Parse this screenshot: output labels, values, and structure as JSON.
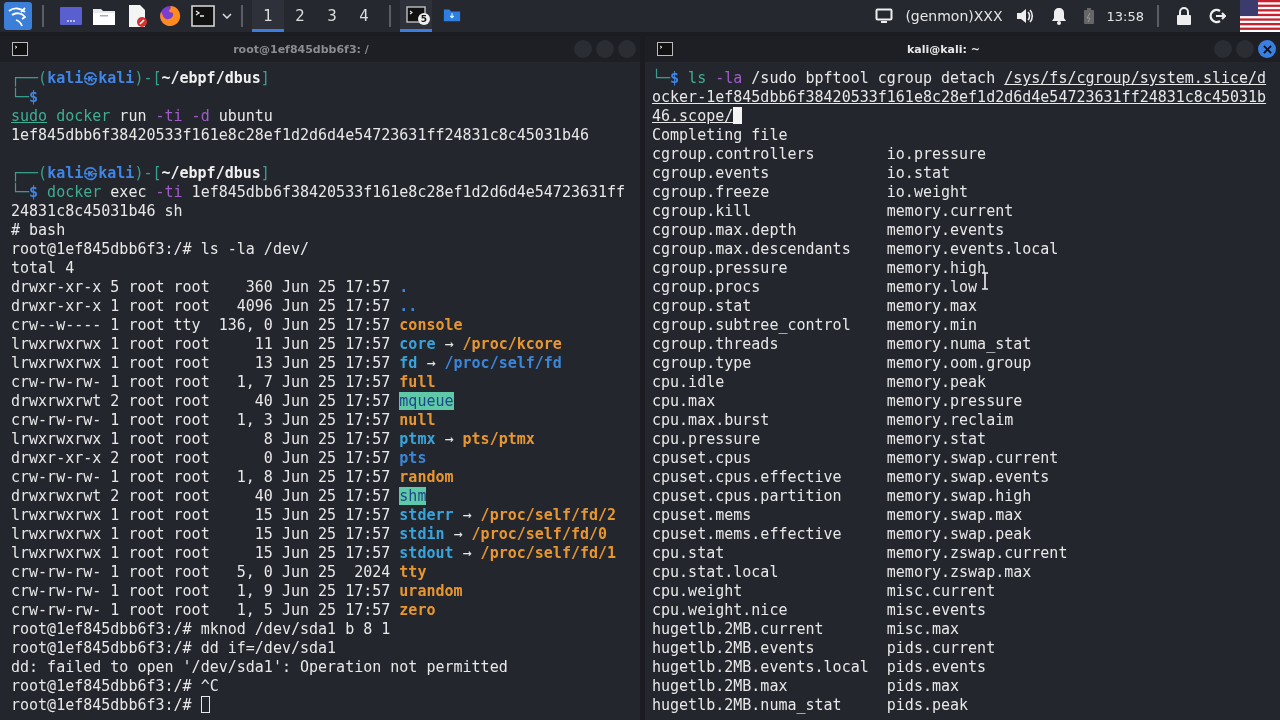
{
  "panel": {
    "workspaces": [
      {
        "label": "1",
        "selected": true
      },
      {
        "label": "2",
        "selected": false
      },
      {
        "label": "3",
        "selected": false
      },
      {
        "label": "4",
        "selected": false
      }
    ],
    "tasks": [
      {
        "kind": "terminal",
        "badge": "5",
        "selected": true
      },
      {
        "kind": "folder",
        "selected": false
      }
    ],
    "genmon": "(genmon)XXX",
    "clock": "13:58"
  },
  "terminals": [
    {
      "title": "root@1ef845dbb6f3: /",
      "active": false,
      "lines": [
        {
          "segs": [
            {
              "text": "┌──(",
              "kind": "frame"
            },
            {
              "text": "kali㉿kali",
              "kind": "host"
            },
            {
              "text": ")-[",
              "kind": "frame"
            },
            {
              "text": "~/ebpf/dbus",
              "kind": "path"
            },
            {
              "text": "]",
              "kind": "frame"
            }
          ]
        },
        {
          "segs": [
            {
              "text": "└─",
              "kind": "frame"
            },
            {
              "text": "$",
              "kind": "dollar"
            }
          ]
        },
        {
          "segs": [
            {
              "text": "sudo",
              "kind": "underlined"
            },
            {
              "text": " docker",
              "kind": "command"
            },
            {
              "text": " run ",
              "kind": "plain"
            },
            {
              "text": "-ti -d",
              "kind": "option"
            },
            {
              "text": " ubuntu",
              "kind": "plain"
            }
          ]
        },
        {
          "segs": [
            {
              "text": "1ef845dbb6f38420533f161e8c28ef1d2d6d4e54723631ff24831c8c45031b46",
              "kind": "plain"
            }
          ]
        },
        {
          "kind": "blank"
        },
        {
          "segs": [
            {
              "text": "┌──(",
              "kind": "frame"
            },
            {
              "text": "kali㉿kali",
              "kind": "host"
            },
            {
              "text": ")-[",
              "kind": "frame"
            },
            {
              "text": "~/ebpf/dbus",
              "kind": "path"
            },
            {
              "text": "]",
              "kind": "frame"
            }
          ]
        },
        {
          "segs": [
            {
              "text": "└─",
              "kind": "frame"
            },
            {
              "text": "$",
              "kind": "dollar"
            },
            {
              "text": " docker",
              "kind": "command"
            },
            {
              "text": " exec ",
              "kind": "plain"
            },
            {
              "text": "-ti",
              "kind": "option"
            },
            {
              "text": " 1ef845dbb6f38420533f161e8c28ef1d2d6d4e54723631ff24831c8c45031b46 sh",
              "kind": "plain"
            }
          ]
        },
        {
          "segs": [
            {
              "text": "# bash",
              "kind": "plain"
            }
          ]
        },
        {
          "segs": [
            {
              "text": "root@1ef845dbb6f3:/# ls -la /dev/",
              "kind": "plain"
            }
          ]
        },
        {
          "segs": [
            {
              "text": "total 4",
              "kind": "plain"
            }
          ]
        },
        {
          "segs": [
            {
              "text": "drwxr-xr-x 5 root root    360 Jun 25 17:57 ",
              "kind": "plain"
            },
            {
              "text": ".",
              "kind": "directory"
            }
          ]
        },
        {
          "segs": [
            {
              "text": "drwxr-xr-x 1 root root   4096 Jun 25 17:57 ",
              "kind": "plain"
            },
            {
              "text": "..",
              "kind": "directory"
            }
          ]
        },
        {
          "segs": [
            {
              "text": "crw--w---- 1 root tty  136, 0 Jun 25 17:57 ",
              "kind": "plain"
            },
            {
              "text": "console",
              "kind": "device"
            }
          ]
        },
        {
          "segs": [
            {
              "text": "lrwxrwxrwx 1 root root     11 Jun 25 17:57 ",
              "kind": "plain"
            },
            {
              "text": "core",
              "kind": "symlink"
            },
            {
              "text": " → ",
              "kind": "plain"
            },
            {
              "text": "/proc/kcore",
              "kind": "device"
            }
          ]
        },
        {
          "segs": [
            {
              "text": "lrwxrwxrwx 1 root root     13 Jun 25 17:57 ",
              "kind": "plain"
            },
            {
              "text": "fd",
              "kind": "symlink"
            },
            {
              "text": " → ",
              "kind": "plain"
            },
            {
              "text": "/proc/self/fd",
              "kind": "directory"
            }
          ]
        },
        {
          "segs": [
            {
              "text": "crw-rw-rw- 1 root root   1, 7 Jun 25 17:57 ",
              "kind": "plain"
            },
            {
              "text": "full",
              "kind": "device"
            }
          ]
        },
        {
          "segs": [
            {
              "text": "drwxrwxrwt 2 root root     40 Jun 25 17:57 ",
              "kind": "plain"
            },
            {
              "text": "mqueue",
              "kind": "sticky"
            }
          ]
        },
        {
          "segs": [
            {
              "text": "crw-rw-rw- 1 root root   1, 3 Jun 25 17:57 ",
              "kind": "plain"
            },
            {
              "text": "null",
              "kind": "device"
            }
          ]
        },
        {
          "segs": [
            {
              "text": "lrwxrwxrwx 1 root root      8 Jun 25 17:57 ",
              "kind": "plain"
            },
            {
              "text": "ptmx",
              "kind": "symlink"
            },
            {
              "text": " → ",
              "kind": "plain"
            },
            {
              "text": "pts/ptmx",
              "kind": "device"
            }
          ]
        },
        {
          "segs": [
            {
              "text": "drwxr-xr-x 2 root root      0 Jun 25 17:57 ",
              "kind": "plain"
            },
            {
              "text": "pts",
              "kind": "directory"
            }
          ]
        },
        {
          "segs": [
            {
              "text": "crw-rw-rw- 1 root root   1, 8 Jun 25 17:57 ",
              "kind": "plain"
            },
            {
              "text": "random",
              "kind": "device"
            }
          ]
        },
        {
          "segs": [
            {
              "text": "drwxrwxrwt 2 root root     40 Jun 25 17:57 ",
              "kind": "plain"
            },
            {
              "text": "shm",
              "kind": "sticky"
            }
          ]
        },
        {
          "segs": [
            {
              "text": "lrwxrwxrwx 1 root root     15 Jun 25 17:57 ",
              "kind": "plain"
            },
            {
              "text": "stderr",
              "kind": "symlink"
            },
            {
              "text": " → ",
              "kind": "plain"
            },
            {
              "text": "/proc/self/fd/2",
              "kind": "device"
            }
          ]
        },
        {
          "segs": [
            {
              "text": "lrwxrwxrwx 1 root root     15 Jun 25 17:57 ",
              "kind": "plain"
            },
            {
              "text": "stdin",
              "kind": "symlink"
            },
            {
              "text": " → ",
              "kind": "plain"
            },
            {
              "text": "/proc/self/fd/0",
              "kind": "device"
            }
          ]
        },
        {
          "segs": [
            {
              "text": "lrwxrwxrwx 1 root root     15 Jun 25 17:57 ",
              "kind": "plain"
            },
            {
              "text": "stdout",
              "kind": "symlink"
            },
            {
              "text": " → ",
              "kind": "plain"
            },
            {
              "text": "/proc/self/fd/1",
              "kind": "device"
            }
          ]
        },
        {
          "segs": [
            {
              "text": "crw-rw-rw- 1 root root   5, 0 Jun 25  2024 ",
              "kind": "plain"
            },
            {
              "text": "tty",
              "kind": "device"
            }
          ]
        },
        {
          "segs": [
            {
              "text": "crw-rw-rw- 1 root root   1, 9 Jun 25 17:57 ",
              "kind": "plain"
            },
            {
              "text": "urandom",
              "kind": "device"
            }
          ]
        },
        {
          "segs": [
            {
              "text": "crw-rw-rw- 1 root root   1, 5 Jun 25 17:57 ",
              "kind": "plain"
            },
            {
              "text": "zero",
              "kind": "device"
            }
          ]
        },
        {
          "segs": [
            {
              "text": "root@1ef845dbb6f3:/# mknod /dev/sda1 b 8 1",
              "kind": "plain"
            }
          ]
        },
        {
          "segs": [
            {
              "text": "root@1ef845dbb6f3:/# dd if=/dev/sda1",
              "kind": "plain"
            }
          ]
        },
        {
          "segs": [
            {
              "text": "dd: failed to open '/dev/sda1': Operation not permitted",
              "kind": "plain"
            }
          ]
        },
        {
          "segs": [
            {
              "text": "root@1ef845dbb6f3:/# ^C",
              "kind": "plain"
            }
          ]
        },
        {
          "segs": [
            {
              "text": "root@1ef845dbb6f3:/# ",
              "kind": "plain"
            }
          ],
          "cursor": true
        }
      ]
    },
    {
      "title": "kali@kali: ~",
      "active": true,
      "lines": [
        {
          "segs": [
            {
              "text": "└─",
              "kind": "frame"
            },
            {
              "text": "$",
              "kind": "dollar"
            },
            {
              "text": " ls",
              "kind": "command"
            },
            {
              "text": " -la",
              "kind": "option"
            },
            {
              "text": " /sudo bpftool cgroup detach ",
              "kind": "plain"
            },
            {
              "text": "/sys/fs/cgroup/system.slice/docker-1ef845dbb6f38420533f161e8c28ef1d2d6d4e54723631ff24831c8c45031b46.scope/",
              "kind": "argument"
            }
          ],
          "cursor": true
        },
        {
          "segs": [
            {
              "text": "Completing file",
              "kind": "plain"
            }
          ]
        }
      ],
      "completion": [
        [
          "cgroup.controllers",
          "io.pressure"
        ],
        [
          "cgroup.events",
          "io.stat"
        ],
        [
          "cgroup.freeze",
          "io.weight"
        ],
        [
          "cgroup.kill",
          "memory.current"
        ],
        [
          "cgroup.max.depth",
          "memory.events"
        ],
        [
          "cgroup.max.descendants",
          "memory.events.local"
        ],
        [
          "cgroup.pressure",
          "memory.high"
        ],
        [
          "cgroup.procs",
          "memory.low"
        ],
        [
          "cgroup.stat",
          "memory.max"
        ],
        [
          "cgroup.subtree_control",
          "memory.min"
        ],
        [
          "cgroup.threads",
          "memory.numa_stat"
        ],
        [
          "cgroup.type",
          "memory.oom.group"
        ],
        [
          "cpu.idle",
          "memory.peak"
        ],
        [
          "cpu.max",
          "memory.pressure"
        ],
        [
          "cpu.max.burst",
          "memory.reclaim"
        ],
        [
          "cpu.pressure",
          "memory.stat"
        ],
        [
          "cpuset.cpus",
          "memory.swap.current"
        ],
        [
          "cpuset.cpus.effective",
          "memory.swap.events"
        ],
        [
          "cpuset.cpus.partition",
          "memory.swap.high"
        ],
        [
          "cpuset.mems",
          "memory.swap.max"
        ],
        [
          "cpuset.mems.effective",
          "memory.swap.peak"
        ],
        [
          "cpu.stat",
          "memory.zswap.current"
        ],
        [
          "cpu.stat.local",
          "memory.zswap.max"
        ],
        [
          "cpu.weight",
          "misc.current"
        ],
        [
          "cpu.weight.nice",
          "misc.events"
        ],
        [
          "hugetlb.2MB.current",
          "misc.max"
        ],
        [
          "hugetlb.2MB.events",
          "pids.current"
        ],
        [
          "hugetlb.2MB.events.local",
          "pids.events"
        ],
        [
          "hugetlb.2MB.max",
          "pids.max"
        ],
        [
          "hugetlb.2MB.numa_stat",
          "pids.peak"
        ]
      ]
    }
  ]
}
